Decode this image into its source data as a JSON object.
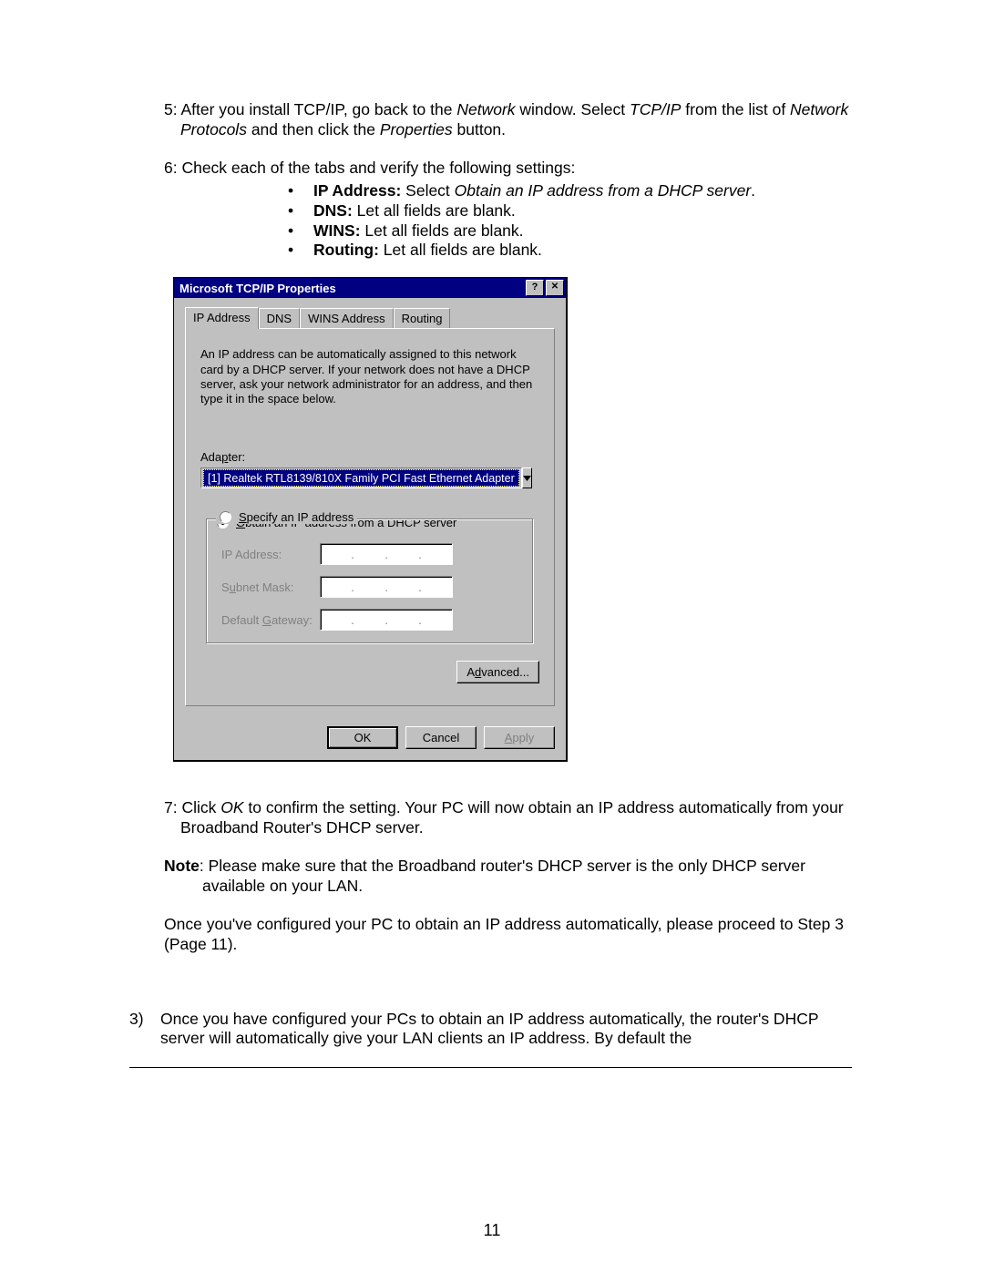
{
  "doc": {
    "step5_a": "5: After you install TCP/IP, go back to the ",
    "step5_b": "Network",
    "step5_c": " window. Select ",
    "step5_d": "TCP/IP",
    "step5_e": " from the list of ",
    "step5_f": "Network Protocols",
    "step5_g": " and then click the ",
    "step5_h": "Properties",
    "step5_i": " button.",
    "step6": "6: Check each of the tabs and verify the following settings:",
    "b1_a": "IP Address:",
    "b1_b": " Select ",
    "b1_c": "Obtain an IP address from a DHCP server",
    "b1_d": ".",
    "b2_a": "DNS:",
    "b2_b": " Let all fields are blank.",
    "b3_a": "WINS:",
    "b3_b": " Let all fields are blank.",
    "b4_a": "Routing:",
    "b4_b": " Let all fields are blank.",
    "step7_a": "7: Click ",
    "step7_b": "OK",
    "step7_c": " to confirm the setting. Your PC will now obtain an IP address automatically from your Broadband Router's DHCP server.",
    "note_a": "Note",
    "note_b": ": Please make sure that the Broadband router's DHCP server is the only DHCP server available on your LAN.",
    "once": "Once you've configured your PC to obtain an IP address automatically, please proceed to Step 3 (Page 11).",
    "s3num": "3)",
    "s3txt": "Once you have configured your PCs to obtain an IP address automatically, the router's DHCP server will automatically give your LAN clients an IP address. By default the",
    "pagenum": "11"
  },
  "dialog": {
    "title": "Microsoft TCP/IP Properties",
    "help": "?",
    "close": "✕",
    "tabs": [
      "IP Address",
      "DNS",
      "WINS Address",
      "Routing"
    ],
    "desc": "An IP address can be automatically assigned to this network card by a DHCP server.  If your network does not have a DHCP server, ask your network administrator for an address, and then type it in the space below.",
    "adapter_label_pre": "Ada",
    "adapter_label_u": "p",
    "adapter_label_post": "ter:",
    "adapter_value": "[1] Realtek RTL8139/810X Family PCI Fast Ethernet Adapter",
    "radio1_u": "O",
    "radio1_rest": "btain an IP address from a DHCP server",
    "radio2_u": "S",
    "radio2_rest": "pecify an IP address",
    "field_ip_pre": "I",
    "field_ip_post": "P Address:",
    "field_sm_pre": "S",
    "field_sm_u": "u",
    "field_sm_post": "bnet Mask:",
    "field_gw_pre": "Default ",
    "field_gw_u": "G",
    "field_gw_post": "ateway:",
    "advanced_pre": "A",
    "advanced_u": "d",
    "advanced_post": "vanced...",
    "ok": "OK",
    "cancel": "Cancel",
    "apply_u": "A",
    "apply_post": "pply"
  }
}
